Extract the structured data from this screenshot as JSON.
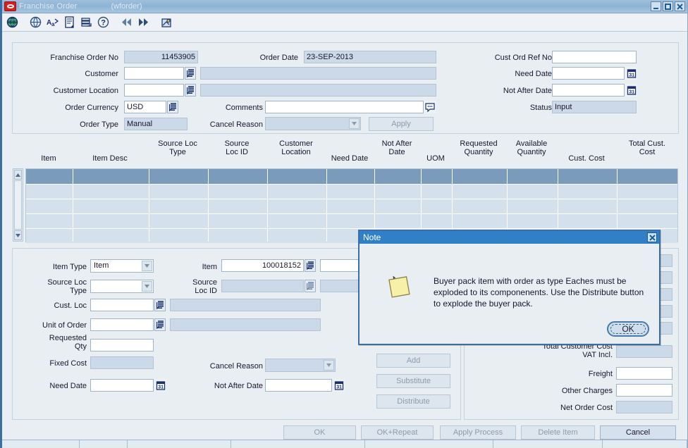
{
  "window": {
    "title": "Franchise Order",
    "module": "(wforder)",
    "buttons": {
      "minimize": "minimize-icon",
      "maximize": "maximize-icon",
      "close": "close-icon"
    }
  },
  "toolbar": {
    "items": [
      {
        "name": "globe-active-icon",
        "title": "Globe"
      },
      {
        "name": "globe-icon",
        "title": "Globe"
      },
      {
        "name": "spellcheck-icon",
        "title": "Spell Check"
      },
      {
        "name": "notes-icon",
        "title": "Notes"
      },
      {
        "name": "print-icon",
        "title": "Print"
      },
      {
        "name": "help-icon",
        "title": "Help"
      },
      {
        "name": "prev-icon",
        "title": "Previous"
      },
      {
        "name": "next-icon",
        "title": "Next"
      },
      {
        "name": "exit-icon",
        "title": "Exit"
      }
    ]
  },
  "header": {
    "franchise_order_no_label": "Franchise Order No",
    "franchise_order_no_value": "11453905",
    "customer_label": "Customer",
    "customer_value": "",
    "customer_desc": "",
    "customer_location_label": "Customer Location",
    "customer_location_value": "",
    "customer_location_desc": "",
    "order_currency_label": "Order Currency",
    "order_currency_value": "USD",
    "order_type_label": "Order Type",
    "order_type_value": "Manual",
    "order_date_label": "Order Date",
    "order_date_value": "23-SEP-2013",
    "comments_label": "Comments",
    "comments_value": "",
    "cancel_reason_label": "Cancel Reason",
    "cancel_reason_value": "",
    "apply_label": "Apply",
    "cust_ord_ref_no_label": "Cust Ord Ref No",
    "cust_ord_ref_no_value": "",
    "need_date_label": "Need Date",
    "need_date_value": "",
    "not_after_date_label": "Not After Date",
    "not_after_date_value": "",
    "status_label": "Status",
    "status_value": "Input"
  },
  "grid": {
    "columns": [
      "Item",
      "Item Desc",
      "Source Loc\nType",
      "Source\nLoc ID",
      "Customer\nLocation",
      "Need Date",
      "Not After\nDate",
      "UOM",
      "Requested\nQuantity",
      "Available\nQuantity",
      "Cust. Cost",
      "Total Cust.\nCost"
    ],
    "rows": [],
    "row_count_visible": 5,
    "selected_row_index": 0,
    "scroll_up_icon": "scroll-up-icon",
    "scroll_down_icon": "scroll-down-icon"
  },
  "detail": {
    "item_type_label": "Item Type",
    "item_type_value": "Item",
    "source_loc_type_label": "Source Loc\nType",
    "source_loc_type_value": "",
    "cust_loc_label": "Cust. Loc",
    "cust_loc_value": "",
    "cust_loc_desc": "",
    "unit_of_order_label": "Unit of Order",
    "unit_of_order_value": "",
    "unit_of_order_desc": "",
    "requested_qty_label": "Requested\nQty",
    "requested_qty_value": "",
    "fixed_cost_label": "Fixed Cost",
    "fixed_cost_value": "",
    "need_date_label": "Need Date",
    "need_date_value": "",
    "item_label": "Item",
    "item_value": "100018152",
    "item_desc": "",
    "source_loc_id_label": "Source\nLoc ID",
    "source_loc_id_value": "",
    "source_loc_id_desc": "",
    "cancel_reason_label": "Cancel Reason",
    "cancel_reason_value": "",
    "not_after_date_label": "Not After Date",
    "not_after_date_value": ""
  },
  "item_actions": {
    "add_label": "Add",
    "substitute_label": "Substitute",
    "distribute_label": "Distribute"
  },
  "totals": {
    "total_customer_cost_vat_incl_label": "Total Customer Cost\nVAT Incl.",
    "total_customer_cost_vat_incl_value": "",
    "freight_label": "Freight",
    "freight_value": "",
    "other_charges_label": "Other Charges",
    "other_charges_value": "",
    "net_order_cost_label": "Net Order Cost",
    "net_order_cost_value": ""
  },
  "footer": {
    "ok_label": "OK",
    "ok_repeat_label": "OK+Repeat",
    "apply_process_label": "Apply Process",
    "delete_item_label": "Delete Item",
    "cancel_label": "Cancel"
  },
  "dialog": {
    "title": "Note",
    "icon": "note-icon",
    "message": "Buyer pack item with order as type Eaches must be exploded to its componenents. Use the Distribute button to explode the buyer pack.",
    "ok_label": "OK",
    "close_icon": "close-icon"
  },
  "colors": {
    "titlebar": "#8db3d4",
    "dialog_title": "#2f80c6",
    "accent_border": "#3b6ea5",
    "grid_selected_row": "#7b9bbd",
    "readonly_field": "#ccd9e8",
    "panel_bg": "#e9eef3"
  }
}
